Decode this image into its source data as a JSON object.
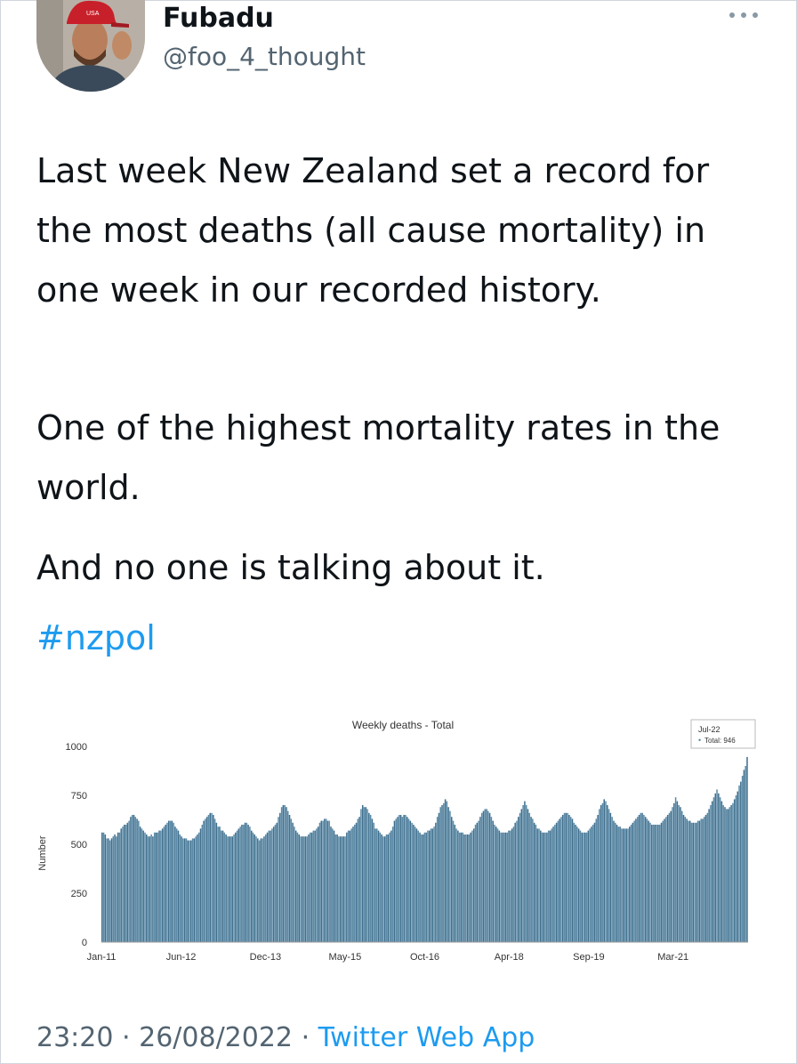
{
  "tweet": {
    "display_name": "Fubadu",
    "handle": "@foo_4_thought",
    "paragraphs": [
      "Last week New Zealand set a record for the most deaths (all cause mortality) in one week in our recorded history.",
      "One of the highest mortality rates in the world.",
      "And no one is talking about it."
    ],
    "hashtag": "#nzpol",
    "time": "23:20",
    "date": "26/08/2022",
    "source": "Twitter Web App",
    "separator": "·",
    "more_icon": "more-horizontal-icon",
    "hat_text": "USA"
  },
  "colors": {
    "accent": "#1d9bf0",
    "bar": "#5a8aa8",
    "bar_edge": "#3f6f8d",
    "muted": "#536471"
  },
  "chart_data": {
    "type": "bar",
    "title": "Weekly deaths - Total",
    "ylabel": "Number",
    "xlabel": "",
    "ylim": [
      0,
      1000
    ],
    "yticks": [
      0,
      250,
      500,
      750,
      1000
    ],
    "xtick_labels": [
      "Jan-11",
      "Jun-12",
      "Dec-13",
      "May-15",
      "Oct-16",
      "Apr-18",
      "Sep-19",
      "Mar-21"
    ],
    "tooltip": {
      "date": "Jul-22",
      "label": "Total: 946",
      "series": "Total",
      "value": 946
    },
    "x_start": "2011-01",
    "x_end": "2022-07",
    "grid": false,
    "series": [
      {
        "name": "Total",
        "values": [
          560,
          560,
          550,
          530,
          530,
          520,
          530,
          540,
          550,
          540,
          560,
          560,
          580,
          590,
          600,
          600,
          610,
          620,
          640,
          650,
          650,
          640,
          630,
          620,
          590,
          580,
          570,
          560,
          550,
          540,
          540,
          550,
          540,
          560,
          560,
          560,
          570,
          570,
          580,
          590,
          600,
          610,
          620,
          620,
          620,
          610,
          590,
          580,
          570,
          550,
          540,
          530,
          530,
          530,
          520,
          520,
          520,
          530,
          530,
          540,
          550,
          560,
          580,
          600,
          620,
          630,
          640,
          650,
          660,
          660,
          650,
          630,
          610,
          590,
          590,
          570,
          570,
          560,
          550,
          540,
          540,
          540,
          540,
          550,
          560,
          570,
          580,
          590,
          600,
          600,
          610,
          610,
          600,
          590,
          570,
          560,
          550,
          540,
          530,
          520,
          530,
          530,
          540,
          550,
          560,
          570,
          570,
          580,
          590,
          600,
          610,
          640,
          660,
          690,
          700,
          700,
          690,
          670,
          650,
          630,
          610,
          590,
          570,
          560,
          550,
          540,
          540,
          540,
          540,
          540,
          550,
          560,
          560,
          570,
          570,
          580,
          590,
          610,
          620,
          620,
          630,
          630,
          620,
          620,
          590,
          580,
          570,
          550,
          550,
          540,
          540,
          540,
          540,
          540,
          560,
          570,
          570,
          580,
          590,
          600,
          610,
          630,
          640,
          680,
          700,
          690,
          690,
          680,
          660,
          650,
          630,
          610,
          580,
          580,
          570,
          560,
          550,
          540,
          540,
          550,
          550,
          560,
          570,
          590,
          620,
          630,
          640,
          650,
          650,
          640,
          650,
          650,
          640,
          630,
          620,
          610,
          600,
          590,
          580,
          570,
          560,
          550,
          550,
          560,
          560,
          570,
          570,
          580,
          580,
          590,
          610,
          640,
          660,
          690,
          700,
          710,
          730,
          720,
          690,
          670,
          640,
          620,
          600,
          580,
          570,
          560,
          560,
          560,
          550,
          550,
          550,
          550,
          560,
          570,
          580,
          600,
          610,
          620,
          640,
          660,
          670,
          680,
          680,
          670,
          660,
          640,
          620,
          600,
          590,
          580,
          570,
          560,
          560,
          560,
          560,
          560,
          570,
          570,
          580,
          590,
          610,
          620,
          640,
          660,
          680,
          700,
          720,
          700,
          680,
          660,
          640,
          630,
          610,
          600,
          580,
          580,
          570,
          560,
          560,
          560,
          560,
          570,
          570,
          580,
          590,
          600,
          610,
          620,
          630,
          640,
          650,
          660,
          660,
          660,
          650,
          640,
          630,
          610,
          600,
          590,
          580,
          570,
          560,
          560,
          560,
          560,
          570,
          580,
          590,
          600,
          610,
          630,
          650,
          680,
          700,
          710,
          730,
          720,
          700,
          680,
          660,
          640,
          620,
          610,
          600,
          590,
          590,
          580,
          580,
          580,
          580,
          580,
          590,
          600,
          610,
          620,
          630,
          640,
          650,
          660,
          660,
          650,
          640,
          630,
          620,
          610,
          600,
          600,
          600,
          600,
          600,
          600,
          610,
          620,
          630,
          640,
          650,
          660,
          670,
          690,
          710,
          740,
          720,
          700,
          690,
          670,
          650,
          640,
          630,
          620,
          620,
          610,
          610,
          610,
          610,
          620,
          620,
          630,
          630,
          640,
          650,
          660,
          680,
          700,
          720,
          740,
          760,
          780,
          760,
          740,
          720,
          700,
          690,
          680,
          680,
          690,
          700,
          710,
          730,
          750,
          770,
          800,
          820,
          850,
          880,
          900,
          946
        ]
      }
    ]
  }
}
